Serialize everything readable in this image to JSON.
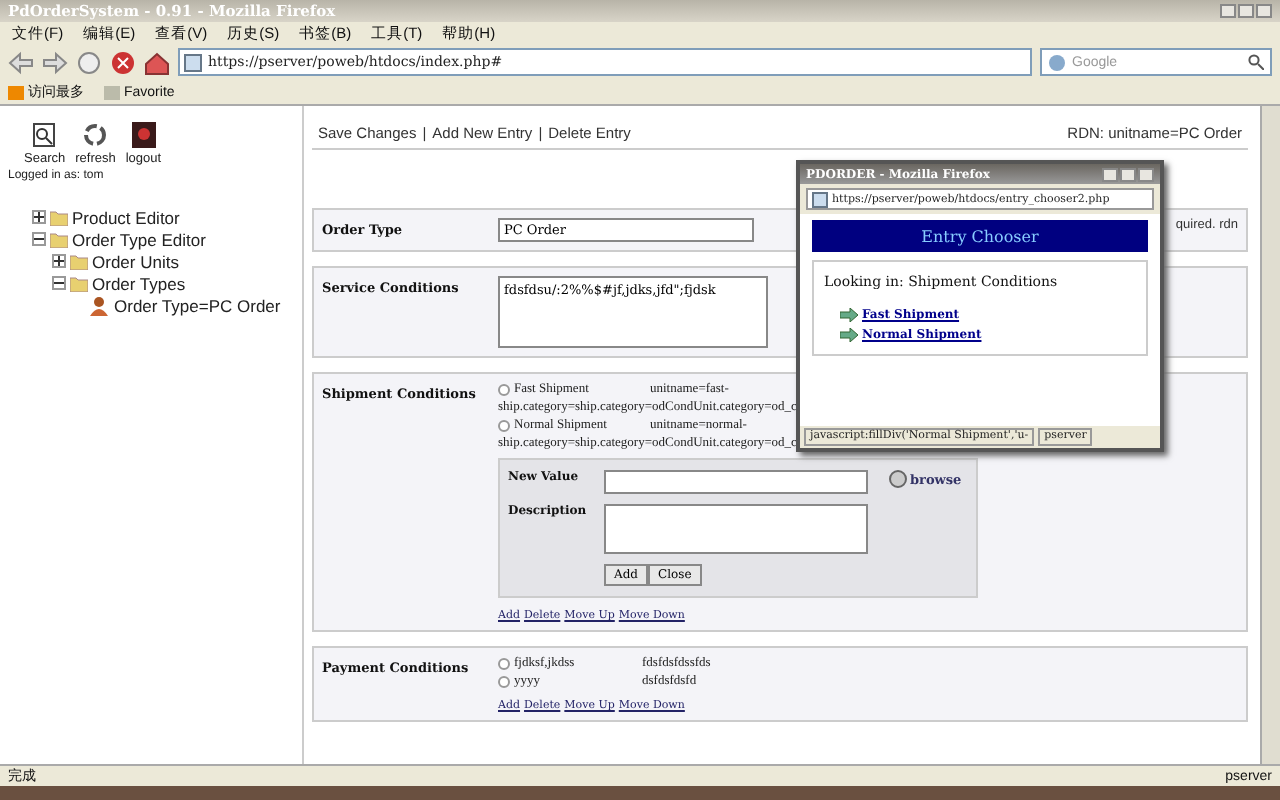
{
  "window": {
    "title": "PdOrderSystem - 0.91 - Mozilla Firefox"
  },
  "menu": [
    "文件(F)",
    "编辑(E)",
    "查看(V)",
    "历史(S)",
    "书签(B)",
    "工具(T)",
    "帮助(H)"
  ],
  "address_bar": {
    "url": "https://pserver/poweb/htdocs/index.php#"
  },
  "search": {
    "placeholder": "Google"
  },
  "bookmarks": [
    {
      "label": "访问最多"
    },
    {
      "label": "Favorite"
    }
  ],
  "sidebar": {
    "tools": [
      {
        "kind": "search",
        "label": "Search"
      },
      {
        "kind": "refresh",
        "label": "refresh"
      },
      {
        "kind": "logout",
        "label": "logout"
      }
    ],
    "login": "Logged in as: tom",
    "tree": [
      {
        "label": "Product Editor",
        "kind": "folder",
        "expanded": false
      },
      {
        "label": "Order Type Editor",
        "kind": "folder",
        "expanded": true,
        "children": [
          {
            "label": "Order Units",
            "kind": "folder",
            "expanded": false
          },
          {
            "label": "Order Types",
            "kind": "folder",
            "expanded": true,
            "children": [
              {
                "label": "Order Type=PC Order",
                "kind": "entry"
              }
            ]
          }
        ]
      }
    ]
  },
  "toolbar": {
    "actions": [
      "Save Changes",
      "Add New Entry",
      "Delete Entry"
    ],
    "separator": "|",
    "rdn": "RDN: unitname=PC Order"
  },
  "order_type": {
    "label": "Order Type",
    "value": "PC Order",
    "note": "quired. rdn"
  },
  "service_conditions": {
    "label": "Service Conditions",
    "value": "fdsfdsu/:2%%$#jf,jdks,jfd\";fjdsk"
  },
  "shipment_conditions": {
    "label": "Shipment Conditions",
    "options": [
      {
        "name": "Fast Shipment",
        "line1": "unitname=fast-",
        "line2": "ship.category=ship.category=odCondUnit.category=od_c",
        "selected": false
      },
      {
        "name": "Normal Shipment",
        "line1": "unitname=normal-",
        "line2": "ship.category=ship.category=odCondUnit.category=od_c",
        "selected": false
      }
    ],
    "new_value": {
      "label": "New Value",
      "browse": "browse"
    },
    "description": {
      "label": "Description"
    },
    "buttons": [
      "Add",
      "Close"
    ],
    "links": [
      "Add",
      "Delete",
      "Move Up",
      "Move Down"
    ]
  },
  "payment_conditions": {
    "label": "Payment Conditions",
    "options": [
      {
        "name": "fjdksf,jkdss",
        "value": "fdsfdsfdssfds",
        "selected": false
      },
      {
        "name": "yyyy",
        "value": "dsfdsfdsfd",
        "selected": false
      }
    ],
    "links": [
      "Add",
      "Delete",
      "Move Up",
      "Move Down"
    ]
  },
  "popup": {
    "title": "PDORDER - Mozilla Firefox",
    "url": "https://pserver/poweb/htdocs/entry_chooser2.php",
    "banner": "Entry Chooser",
    "looking_in": "Looking in: Shipment Conditions",
    "entries": [
      "Fast Shipment",
      "Normal Shipment"
    ],
    "status": "javascript:fillDiv('Normal Shipment','u-",
    "server": "pserver"
  },
  "status_bar": {
    "text": "完成",
    "server": "pserver"
  }
}
